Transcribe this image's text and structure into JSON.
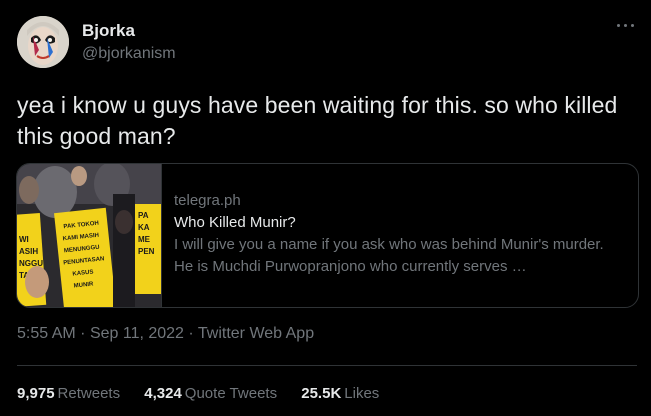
{
  "author": {
    "display_name": "Bjorka",
    "handle": "@bjorkanism",
    "avatar_icon": "avatar-face-icon"
  },
  "menu_icon": "more-horizontal-icon",
  "tweet": {
    "text": "yea i know u guys have been waiting for this. so who killed this good man?"
  },
  "link_card": {
    "domain": "telegra.ph",
    "title": "Who Killed Munir?",
    "description": "I will give you a name if you ask who was behind Munir's murder. He is Muchdi Purwopranjono who currently serves …",
    "image_signs": [
      "PAK TOKOH KAMI MASIH MENUNGGU PENUNTASAN KASUS MUNIR",
      "PA KA ME PEN",
      "WI ASIH NGGU TASAN"
    ]
  },
  "meta": {
    "time": "5:55 AM",
    "separator": "·",
    "date": "Sep 11, 2022",
    "source": "Twitter Web App"
  },
  "stats": {
    "retweets_count": "9,975",
    "retweets_label": "Retweets",
    "quote_count": "4,324",
    "quote_label": "Quote Tweets",
    "likes_count": "25.5K",
    "likes_label": "Likes"
  },
  "colors": {
    "background": "#000000",
    "text_primary": "#e7e9ea",
    "text_secondary": "#71767b",
    "border": "#2f3336",
    "sign_yellow": "#f2d21b"
  }
}
